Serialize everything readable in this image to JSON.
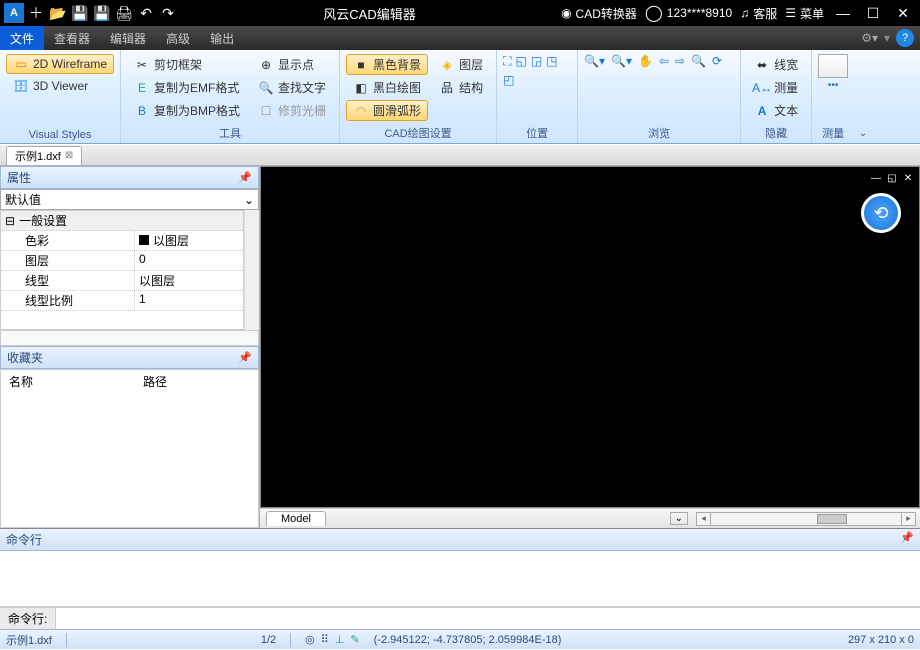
{
  "titlebar": {
    "app_title": "风云CAD编辑器",
    "converter": "CAD转换器",
    "user": "123****8910",
    "support": "客服",
    "menu": "菜单"
  },
  "menubar": {
    "items": [
      "文件",
      "查看器",
      "编辑器",
      "高级",
      "输出"
    ]
  },
  "ribbon": {
    "visual_styles": {
      "label": "Visual Styles",
      "wireframe": "2D Wireframe",
      "viewer3d": "3D Viewer"
    },
    "tools": {
      "label": "工具",
      "clip": "剪切框架",
      "copy_emf": "复制为EMF格式",
      "copy_bmp": "复制为BMP格式",
      "show_point": "显示点",
      "find_text": "查找文字",
      "trim": "修剪光栅"
    },
    "draw_settings": {
      "label": "CAD绘图设置",
      "black_bg": "黑色背景",
      "bw_draw": "黑白绘图",
      "smooth_arc": "圆滑弧形",
      "layers": "图层",
      "struct": "结构"
    },
    "position": {
      "label": "位置"
    },
    "browse": {
      "label": "浏览"
    },
    "hide": {
      "label": "隐藏",
      "line_width": "线宽",
      "measure": "测量",
      "text": "文本"
    },
    "measure": {
      "label": "测量"
    }
  },
  "tabs": {
    "file1": "示例1.dxf"
  },
  "properties": {
    "title": "属性",
    "default": "默认值",
    "general": "一般设置",
    "rows": {
      "color": "色彩",
      "color_val": "以图层",
      "layer": "图层",
      "layer_val": "0",
      "linetype": "线型",
      "linetype_val": "以图层",
      "lt_scale": "线型比例",
      "lt_scale_val": "1"
    }
  },
  "favorites": {
    "title": "收藏夹",
    "col_name": "名称",
    "col_path": "路径"
  },
  "model_tab": "Model",
  "command": {
    "title": "命令行",
    "prompt": "命令行:"
  },
  "status": {
    "file": "示例1.dxf",
    "page": "1/2",
    "coords": "(-2.945122; -4.737805; 2.059984E-18)",
    "dims": "297 x 210 x 0"
  }
}
